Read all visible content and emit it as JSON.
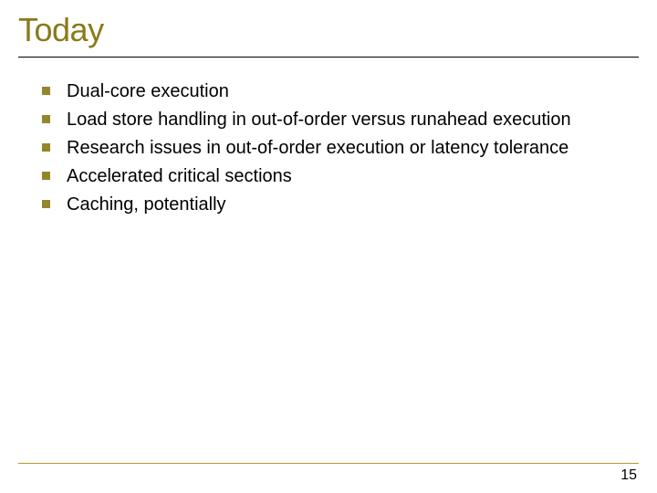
{
  "title": "Today",
  "bullets": [
    "Dual-core execution",
    "Load store handling in out-of-order versus runahead execution",
    "Research issues in out-of-order execution or latency tolerance",
    "Accelerated critical sections",
    "Caching, potentially"
  ],
  "page_number": "15"
}
